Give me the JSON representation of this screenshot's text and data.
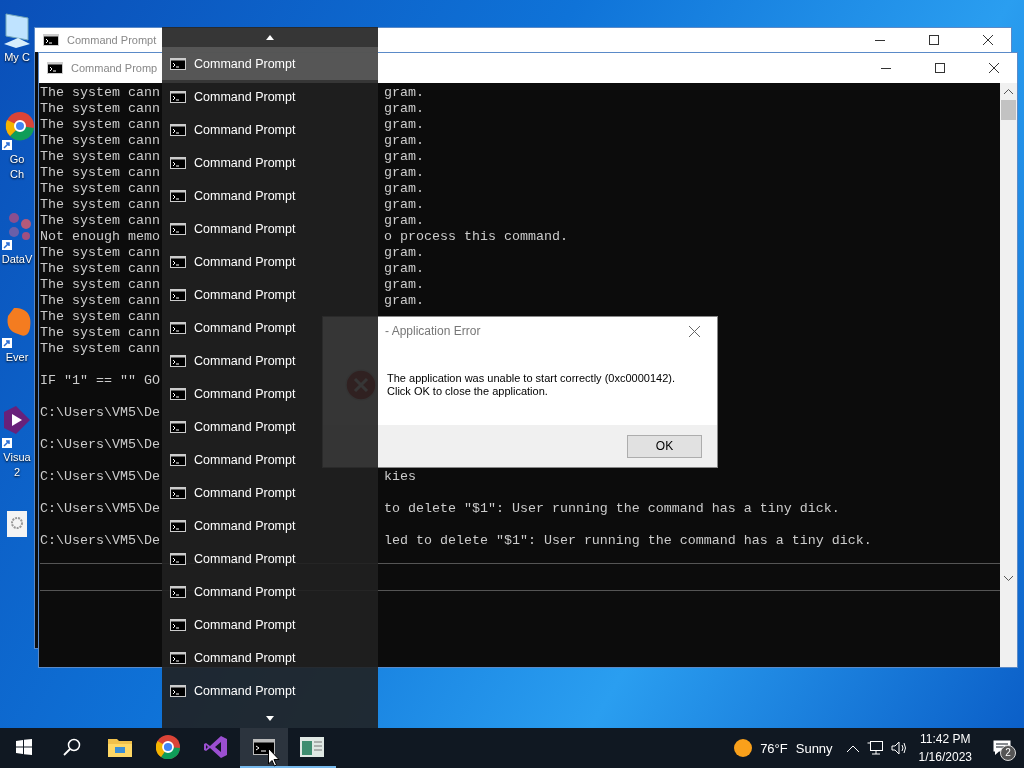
{
  "desktop_icons": [
    {
      "kind": "computer",
      "lines": [
        "My C"
      ]
    },
    {
      "kind": "chrome",
      "lines": [
        "Go",
        "Ch"
      ]
    },
    {
      "kind": "dataviz",
      "lines": [
        "DataV"
      ]
    },
    {
      "kind": "evernote",
      "lines": [
        "Ever"
      ]
    },
    {
      "kind": "visualstudio",
      "lines": [
        "Visua",
        "2"
      ]
    },
    {
      "kind": "settings"
    }
  ],
  "back_window": {
    "title": "Command Prompt"
  },
  "front_window": {
    "title": "Command Promp",
    "console_lines": [
      {
        "left": "The system cann",
        "right": "gram."
      },
      {
        "left": "The system cann",
        "right": "gram."
      },
      {
        "left": "The system cann",
        "right": "gram."
      },
      {
        "left": "The system cann",
        "right": "gram."
      },
      {
        "left": "The system cann",
        "right": "gram."
      },
      {
        "left": "The system cann",
        "right": "gram."
      },
      {
        "left": "The system cann",
        "right": "gram."
      },
      {
        "left": "The system cann",
        "right": "gram."
      },
      {
        "left": "The system cann",
        "right": "gram."
      },
      {
        "left": "Not enough memo",
        "right": "o process this command."
      },
      {
        "left": "The system cann",
        "right": "gram."
      },
      {
        "left": "The system cann",
        "right": "gram."
      },
      {
        "left": "The system cann",
        "right": "gram."
      },
      {
        "left": "The system cann",
        "right": "gram."
      },
      {
        "left": "The system cann"
      },
      {
        "left": "The system cann"
      },
      {
        "left": "The system cann"
      },
      {
        "left": "IF \"1\" == \"\" GO",
        "gap": true
      },
      {
        "left": "C:\\Users\\VM5\\De",
        "gap": true
      },
      {
        "left": "C:\\Users\\VM5\\De",
        "gap": true
      },
      {
        "left": "C:\\Users\\VM5\\De",
        "right": "kies",
        "gap": true
      },
      {
        "left": "C:\\Users\\VM5\\De",
        "right": "to delete \"$1\": User running the command has a tiny dick.",
        "gap": true
      },
      {
        "left": "C:\\Users\\VM5\\De",
        "right": "led to delete \"$1\": User running the command has a tiny dick.",
        "gap": true
      }
    ]
  },
  "dialog": {
    "title": "- Application Error",
    "message": [
      "The application was unable to start correctly (0xc0000142).",
      "Click OK to close the application."
    ],
    "button": "OK"
  },
  "jump_list": {
    "items": [
      {
        "label": "Command Prompt",
        "selected": true
      },
      {
        "label": "Command Prompt",
        "selected": false
      },
      {
        "label": "Command Prompt",
        "selected": false
      },
      {
        "label": "Command Prompt",
        "selected": false
      },
      {
        "label": "Command Prompt",
        "selected": false
      },
      {
        "label": "Command Prompt",
        "selected": false
      },
      {
        "label": "Command Prompt",
        "selected": false
      },
      {
        "label": "Command Prompt",
        "selected": false
      },
      {
        "label": "Command Prompt",
        "selected": false
      },
      {
        "label": "Command Prompt",
        "selected": false
      },
      {
        "label": "Command Prompt",
        "selected": false
      },
      {
        "label": "Command Prompt",
        "selected": false
      },
      {
        "label": "Command Prompt",
        "selected": false
      },
      {
        "label": "Command Prompt",
        "selected": false
      },
      {
        "label": "Command Prompt",
        "selected": false
      },
      {
        "label": "Command Prompt",
        "selected": false
      },
      {
        "label": "Command Prompt",
        "selected": false
      },
      {
        "label": "Command Prompt",
        "selected": false
      },
      {
        "label": "Command Prompt",
        "selected": false
      },
      {
        "label": "Command Prompt",
        "selected": false
      }
    ]
  },
  "taskbar": {
    "items": [
      {
        "kind": "start",
        "active": false,
        "running": false
      },
      {
        "kind": "search",
        "active": false,
        "running": false
      },
      {
        "kind": "explorer",
        "active": false,
        "running": false
      },
      {
        "kind": "chrome",
        "active": false,
        "running": false
      },
      {
        "kind": "visualstudio",
        "active": false,
        "running": false
      },
      {
        "kind": "console",
        "active": true,
        "running": true
      },
      {
        "kind": "editor",
        "active": false,
        "running": true
      }
    ],
    "weather": {
      "temperature": "76°F",
      "condition": "Sunny"
    },
    "clock": {
      "time": "11:42 PM",
      "date": "1/16/2023"
    },
    "notifications": {
      "count": "2"
    }
  }
}
